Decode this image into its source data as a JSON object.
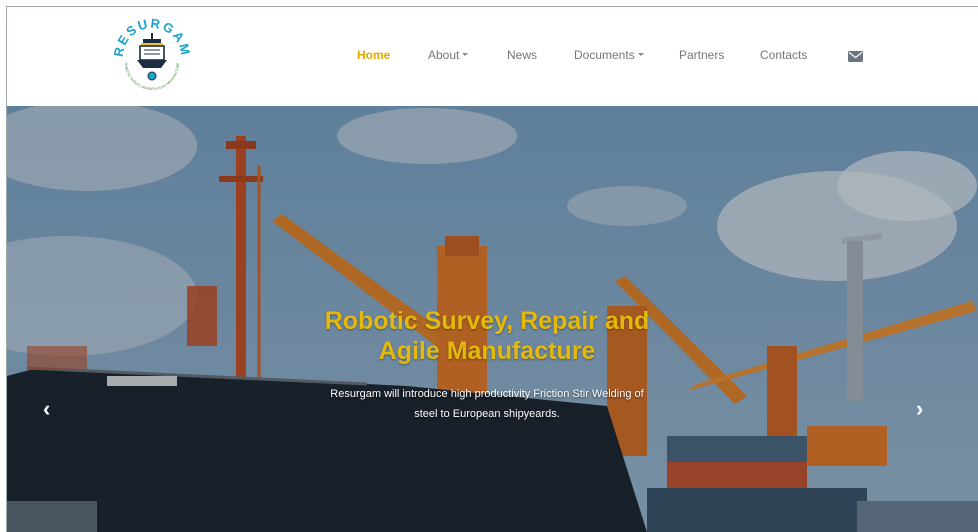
{
  "logo": {
    "text": "RESURGAM",
    "tagline": "ROBOTIC SURVEY, REPAIR & AGILE MANUFACTURE"
  },
  "nav": {
    "home": "Home",
    "about": "About",
    "news": "News",
    "documents": "Documents",
    "partners": "Partners",
    "contacts": "Contacts"
  },
  "hero": {
    "title_line1": "Robotic Survey, Repair and",
    "title_line2": "Agile Manufacture",
    "subtitle_line1": "Resurgam will introduce high productivity Friction Stir Welding of",
    "subtitle_line2": "steel to European shipyeards."
  },
  "colors": {
    "accent": "#e4b90c",
    "nav_active": "#e0a800",
    "ship_hull": "#1f2a36",
    "crane": "#e07b2c"
  },
  "icons": {
    "mail": "envelope-icon",
    "prev": "chevron-left-icon",
    "next": "chevron-right-icon"
  }
}
